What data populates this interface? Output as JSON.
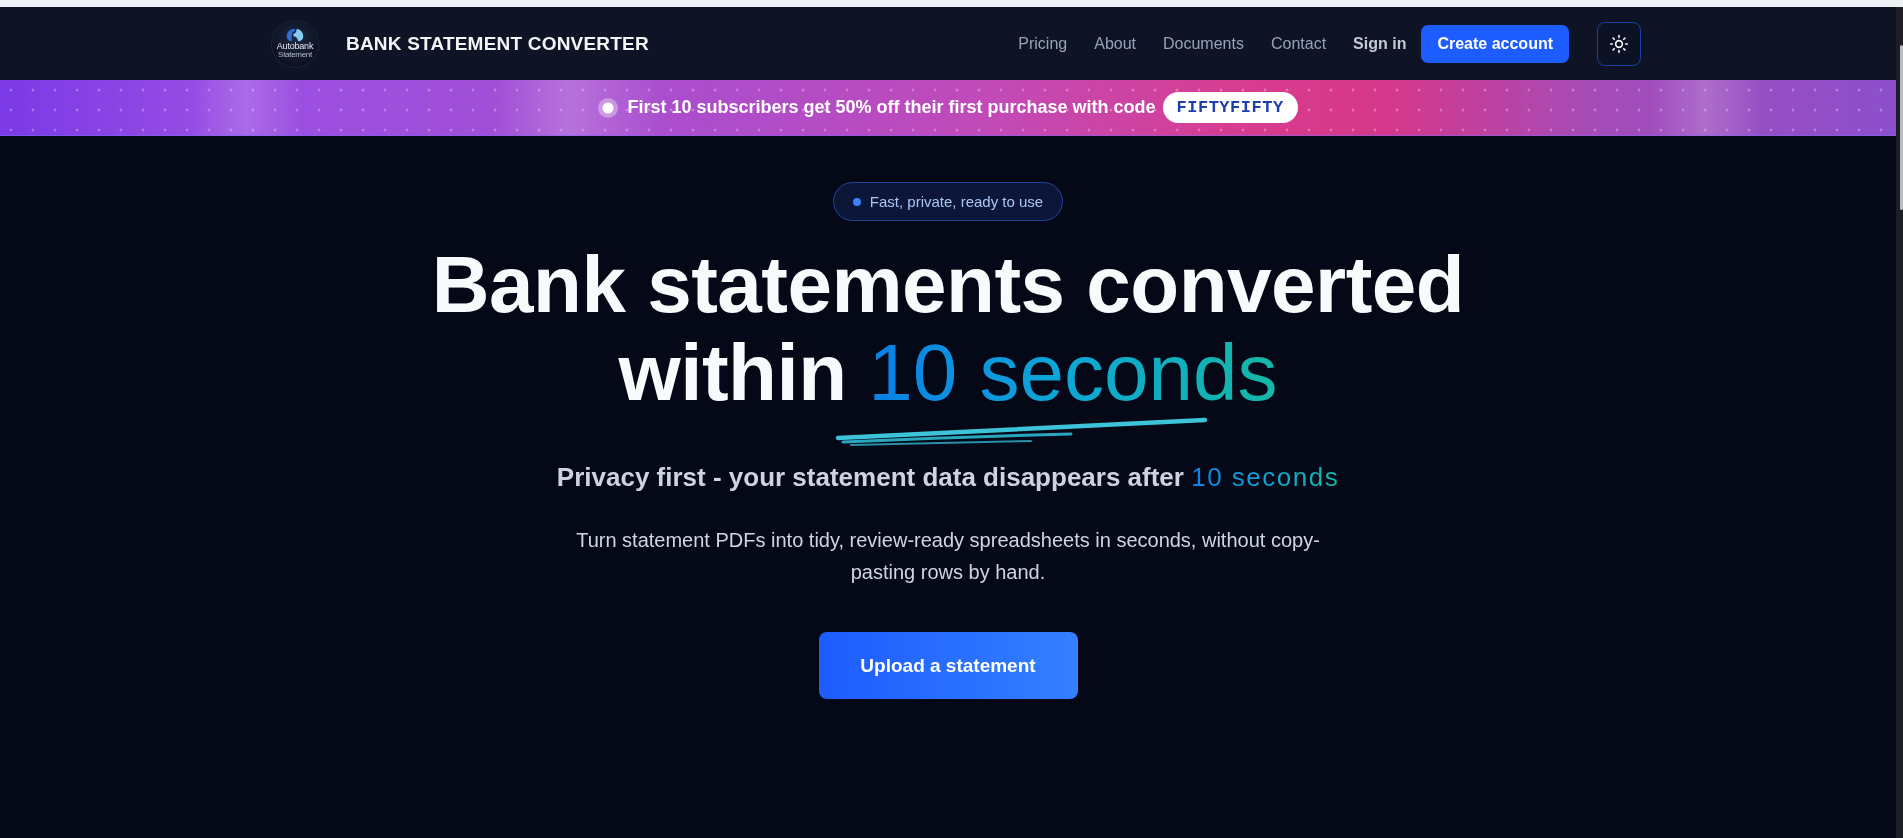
{
  "header": {
    "logo": {
      "name": "Autobank",
      "tagline": "Statement"
    },
    "title": "BANK STATEMENT CONVERTER",
    "nav": [
      {
        "label": "Pricing"
      },
      {
        "label": "About"
      },
      {
        "label": "Documents"
      },
      {
        "label": "Contact"
      }
    ],
    "sign_in": "Sign in",
    "primary_action": "Create account"
  },
  "promo": {
    "text": "First 10 subscribers get **50% off** their first purchase with code",
    "code": "FIFTYFIFTY"
  },
  "hero": {
    "badge": "Fast, private, ready to use",
    "heading": {
      "text": "Bank statements converted within",
      "highlight": "10 seconds"
    },
    "subtitle": {
      "text": "Privacy first - your statement data disappears after",
      "highlight": "10 seconds"
    },
    "description": "Turn statement PDFs into tidy, review-ready spreadsheets in seconds, without copy-pasting rows by hand.",
    "upload_button": "Upload a statement"
  }
}
